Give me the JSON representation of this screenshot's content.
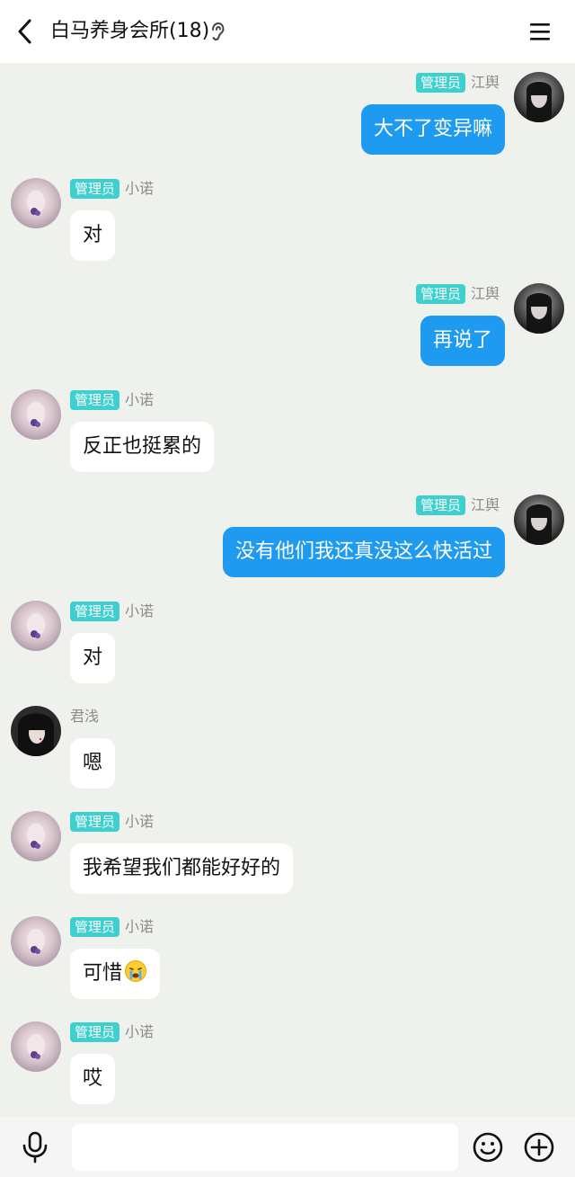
{
  "header": {
    "title": "白马养身会所(18)",
    "back_icon": "back-arrow-icon",
    "ear_icon": "listen-mode-ear-icon",
    "menu_icon": "hamburger-menu-icon"
  },
  "messages": [
    {
      "side": "out",
      "badge": "管理员",
      "name": "江舆",
      "text": "大不了变异嘛"
    },
    {
      "side": "in",
      "badge": "管理员",
      "name": "小诺",
      "text": "对"
    },
    {
      "side": "out",
      "badge": "管理员",
      "name": "江舆",
      "text": "再说了"
    },
    {
      "side": "in",
      "badge": "管理员",
      "name": "小诺",
      "text": "反正也挺累的"
    },
    {
      "side": "out",
      "badge": "管理员",
      "name": "江舆",
      "text": "没有他们我还真没这么快活过"
    },
    {
      "side": "in",
      "badge": "管理员",
      "name": "小诺",
      "text": "对"
    },
    {
      "side": "in",
      "badge": "",
      "name": "君浅",
      "text": "嗯"
    },
    {
      "side": "in",
      "badge": "管理员",
      "name": "小诺",
      "text": "我希望我们都能好好的"
    },
    {
      "side": "in",
      "badge": "管理员",
      "name": "小诺",
      "text": "可惜",
      "emoji": "crying-face-emoji"
    },
    {
      "side": "in",
      "badge": "管理员",
      "name": "小诺",
      "text": "哎"
    }
  ],
  "bottom_bar": {
    "voice_icon": "microphone-icon",
    "input_value": "",
    "emoji_icon": "smiley-icon",
    "more_icon": "plus-circle-icon"
  },
  "colors": {
    "background": "#eef1ec",
    "badge": "#3ecfcf",
    "outgoing_bubble": "#1e9bf0",
    "incoming_bubble": "#ffffff"
  }
}
